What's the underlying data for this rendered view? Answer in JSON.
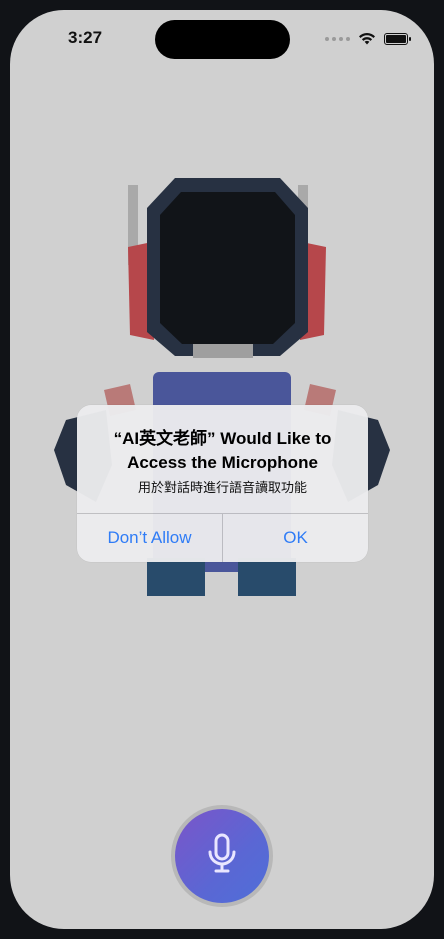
{
  "status_bar": {
    "time": "3:27",
    "icons": [
      "signal-dots-icon",
      "wifi-icon",
      "battery-icon"
    ]
  },
  "alert": {
    "title": "“AI英文老師” Would Like to Access the Microphone",
    "message": "用於對話時進行語音讀取功能",
    "buttons": {
      "dont_allow": "Don’t Allow",
      "ok": "OK"
    }
  },
  "mic": {
    "icon": "microphone-icon"
  },
  "colors": {
    "screen_background": "#d0d0d0",
    "alert_button_text": "#2f7cf6",
    "mic_gradient_start": "#7b55c9",
    "mic_gradient_end": "#4f6fd8",
    "robot_head": "#273142",
    "robot_ears": "#b6474b",
    "robot_body": "#4a569a"
  }
}
